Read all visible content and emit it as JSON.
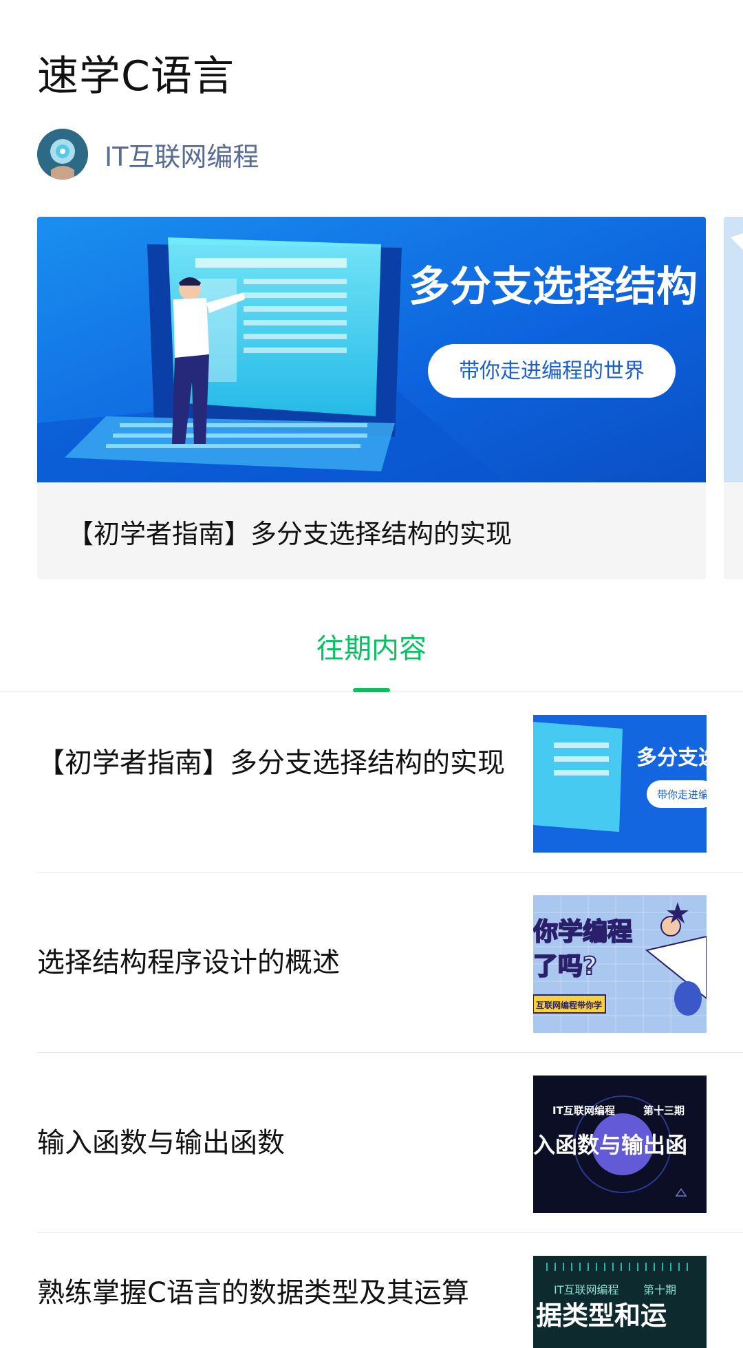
{
  "album": {
    "title": "速学C语言",
    "author": {
      "name": "IT互联网编程",
      "avatar_icon": "avatar-globe-icon"
    }
  },
  "featured": {
    "banner": {
      "headline": "多分支选择结构",
      "pill_text": "带你走进编程的世界"
    },
    "title": "【初学者指南】多分支选择结构的实现"
  },
  "tabs": [
    {
      "label": "往期内容",
      "active": true
    }
  ],
  "articles": [
    {
      "title": "【初学者指南】多分支选择结构的实现",
      "thumb_text": [
        "多分支选",
        "带你走进编"
      ]
    },
    {
      "title": "选择结构程序设计的概述",
      "thumb_text": [
        "你学编程",
        "了吗?",
        "互联网编程带你学"
      ]
    },
    {
      "title": "输入函数与输出函数",
      "thumb_text": [
        "IT互联网编程",
        "第十三期",
        "入函数与输出函"
      ]
    },
    {
      "title": "熟练掌握C语言的数据类型及其运算",
      "thumb_text": [
        "IT互联网编程",
        "第十期",
        "据类型和运"
      ]
    }
  ],
  "colors": {
    "accent": "#07c160",
    "link": "#576b95",
    "banner_blue": "#1565e0"
  }
}
